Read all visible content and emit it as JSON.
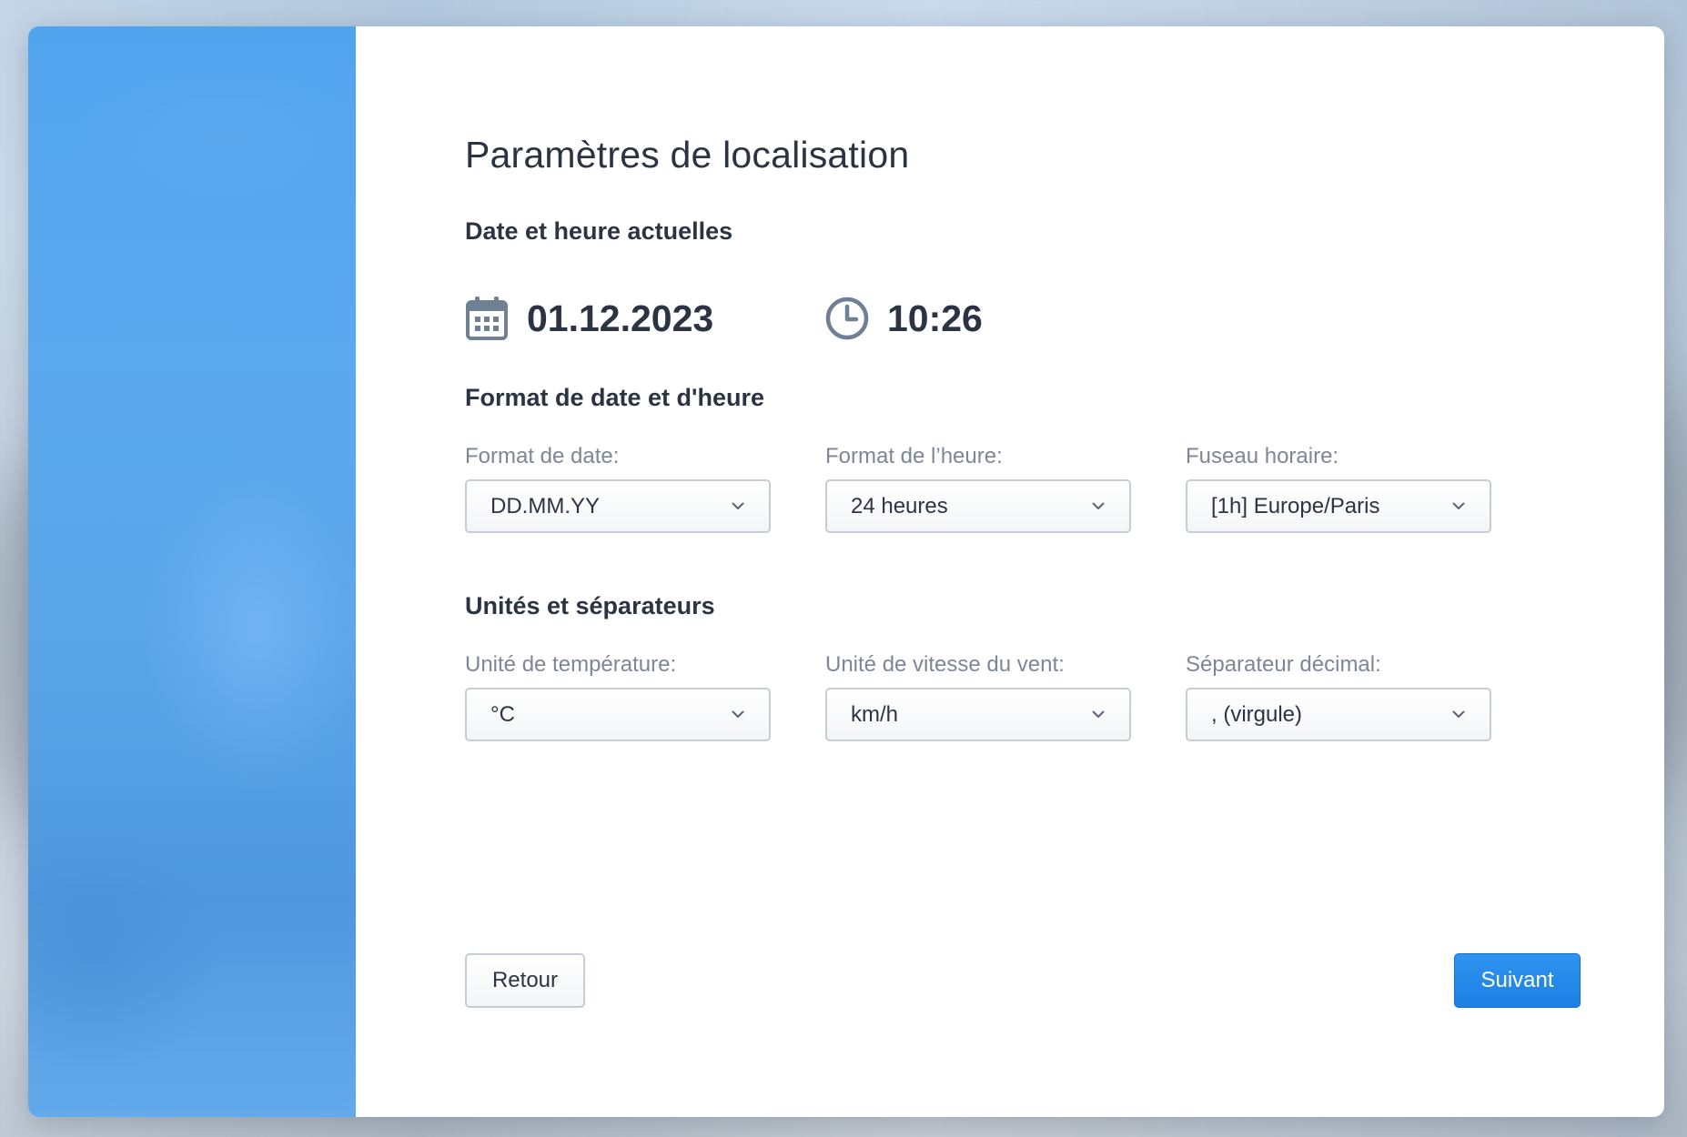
{
  "page": {
    "title": "Paramètres de localisation"
  },
  "current": {
    "heading": "Date et heure actuelles",
    "date_icon": "calendar-icon",
    "date": "01.12.2023",
    "time_icon": "clock-icon",
    "time": "10:26"
  },
  "format": {
    "heading": "Format de date et d'heure",
    "fields": [
      {
        "label": "Format de date:",
        "value": "DD.MM.YY"
      },
      {
        "label": "Format de l’heure:",
        "value": "24 heures"
      },
      {
        "label": "Fuseau horaire:",
        "value": "[1h] Europe/Paris"
      }
    ]
  },
  "units": {
    "heading": "Unités et séparateurs",
    "fields": [
      {
        "label": "Unité de température:",
        "value": "°C"
      },
      {
        "label": "Unité de vitesse du vent:",
        "value": "km/h"
      },
      {
        "label": "Séparateur décimal:",
        "value": ", (virgule)"
      }
    ]
  },
  "actions": {
    "back_label": "Retour",
    "next_label": "Suivant"
  },
  "colors": {
    "sidebar": "#50a4ee",
    "accent": "#1b80e3",
    "text": "#2c3444",
    "muted": "#7d8797",
    "icon": "#6f7f94"
  }
}
